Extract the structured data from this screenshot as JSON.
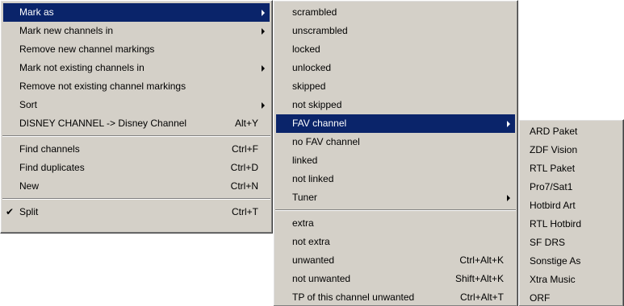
{
  "menu1": {
    "items": [
      {
        "label": "Mark as",
        "shortcut": "",
        "submenu": true,
        "selected": true
      },
      {
        "label": "Mark new channels in",
        "shortcut": "",
        "submenu": true
      },
      {
        "label": "Remove new channel markings",
        "shortcut": ""
      },
      {
        "label": "Mark not existing channels in",
        "shortcut": "",
        "submenu": true
      },
      {
        "label": "Remove not existing channel markings",
        "shortcut": ""
      },
      {
        "label": "Sort",
        "shortcut": "",
        "submenu": true
      },
      {
        "label": "DISNEY CHANNEL -> Disney Channel",
        "shortcut": "Alt+Y"
      },
      {
        "label": "Find channels",
        "shortcut": "Ctrl+F"
      },
      {
        "label": "Find duplicates",
        "shortcut": "Ctrl+D"
      },
      {
        "label": "New",
        "shortcut": "Ctrl+N"
      },
      {
        "label": "Split",
        "shortcut": "Ctrl+T",
        "checked": true,
        "check_glyph": "✔"
      }
    ]
  },
  "menu2": {
    "items": [
      {
        "label": "scrambled",
        "shortcut": ""
      },
      {
        "label": "unscrambled",
        "shortcut": ""
      },
      {
        "label": "locked",
        "shortcut": ""
      },
      {
        "label": "unlocked",
        "shortcut": ""
      },
      {
        "label": "skipped",
        "shortcut": ""
      },
      {
        "label": "not skipped",
        "shortcut": ""
      },
      {
        "label": "FAV channel",
        "shortcut": "",
        "submenu": true,
        "selected": true
      },
      {
        "label": "no FAV channel",
        "shortcut": ""
      },
      {
        "label": "linked",
        "shortcut": ""
      },
      {
        "label": "not linked",
        "shortcut": ""
      },
      {
        "label": "Tuner",
        "shortcut": "",
        "submenu": true
      },
      {
        "label": "extra",
        "shortcut": ""
      },
      {
        "label": "not extra",
        "shortcut": ""
      },
      {
        "label": "unwanted",
        "shortcut": "Ctrl+Alt+K"
      },
      {
        "label": "not unwanted",
        "shortcut": "Shift+Alt+K"
      },
      {
        "label": "TP of this channel unwanted",
        "shortcut": "Ctrl+Alt+T"
      }
    ]
  },
  "menu3": {
    "items": [
      {
        "label": "ARD Paket"
      },
      {
        "label": "ZDF Vision"
      },
      {
        "label": "RTL Paket"
      },
      {
        "label": "Pro7/Sat1"
      },
      {
        "label": "Hotbird Art"
      },
      {
        "label": "RTL Hotbird"
      },
      {
        "label": "SF DRS"
      },
      {
        "label": "Sonstige As"
      },
      {
        "label": "Xtra Music"
      },
      {
        "label": "ORF"
      }
    ]
  },
  "colors": {
    "menu_bg": "#d4d0c8",
    "highlight": "#0a246a",
    "highlight_text": "#ffffff"
  }
}
